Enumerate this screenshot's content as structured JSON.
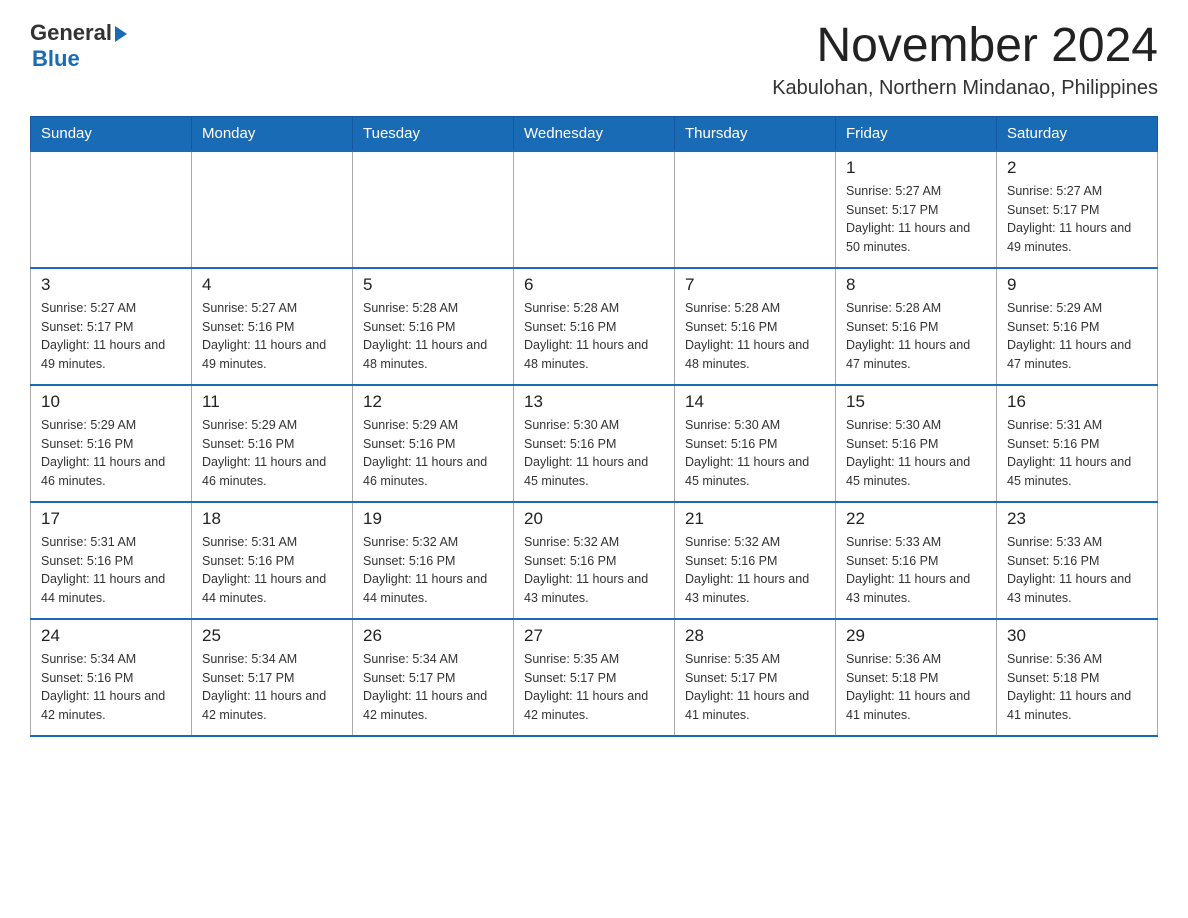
{
  "header": {
    "logo": {
      "general": "General",
      "blue": "Blue",
      "line2": "Blue"
    },
    "title": "November 2024",
    "subtitle": "Kabulohan, Northern Mindanao, Philippines"
  },
  "weekdays": [
    "Sunday",
    "Monday",
    "Tuesday",
    "Wednesday",
    "Thursday",
    "Friday",
    "Saturday"
  ],
  "weeks": [
    [
      {
        "day": "",
        "info": ""
      },
      {
        "day": "",
        "info": ""
      },
      {
        "day": "",
        "info": ""
      },
      {
        "day": "",
        "info": ""
      },
      {
        "day": "",
        "info": ""
      },
      {
        "day": "1",
        "info": "Sunrise: 5:27 AM\nSunset: 5:17 PM\nDaylight: 11 hours and 50 minutes."
      },
      {
        "day": "2",
        "info": "Sunrise: 5:27 AM\nSunset: 5:17 PM\nDaylight: 11 hours and 49 minutes."
      }
    ],
    [
      {
        "day": "3",
        "info": "Sunrise: 5:27 AM\nSunset: 5:17 PM\nDaylight: 11 hours and 49 minutes."
      },
      {
        "day": "4",
        "info": "Sunrise: 5:27 AM\nSunset: 5:16 PM\nDaylight: 11 hours and 49 minutes."
      },
      {
        "day": "5",
        "info": "Sunrise: 5:28 AM\nSunset: 5:16 PM\nDaylight: 11 hours and 48 minutes."
      },
      {
        "day": "6",
        "info": "Sunrise: 5:28 AM\nSunset: 5:16 PM\nDaylight: 11 hours and 48 minutes."
      },
      {
        "day": "7",
        "info": "Sunrise: 5:28 AM\nSunset: 5:16 PM\nDaylight: 11 hours and 48 minutes."
      },
      {
        "day": "8",
        "info": "Sunrise: 5:28 AM\nSunset: 5:16 PM\nDaylight: 11 hours and 47 minutes."
      },
      {
        "day": "9",
        "info": "Sunrise: 5:29 AM\nSunset: 5:16 PM\nDaylight: 11 hours and 47 minutes."
      }
    ],
    [
      {
        "day": "10",
        "info": "Sunrise: 5:29 AM\nSunset: 5:16 PM\nDaylight: 11 hours and 46 minutes."
      },
      {
        "day": "11",
        "info": "Sunrise: 5:29 AM\nSunset: 5:16 PM\nDaylight: 11 hours and 46 minutes."
      },
      {
        "day": "12",
        "info": "Sunrise: 5:29 AM\nSunset: 5:16 PM\nDaylight: 11 hours and 46 minutes."
      },
      {
        "day": "13",
        "info": "Sunrise: 5:30 AM\nSunset: 5:16 PM\nDaylight: 11 hours and 45 minutes."
      },
      {
        "day": "14",
        "info": "Sunrise: 5:30 AM\nSunset: 5:16 PM\nDaylight: 11 hours and 45 minutes."
      },
      {
        "day": "15",
        "info": "Sunrise: 5:30 AM\nSunset: 5:16 PM\nDaylight: 11 hours and 45 minutes."
      },
      {
        "day": "16",
        "info": "Sunrise: 5:31 AM\nSunset: 5:16 PM\nDaylight: 11 hours and 45 minutes."
      }
    ],
    [
      {
        "day": "17",
        "info": "Sunrise: 5:31 AM\nSunset: 5:16 PM\nDaylight: 11 hours and 44 minutes."
      },
      {
        "day": "18",
        "info": "Sunrise: 5:31 AM\nSunset: 5:16 PM\nDaylight: 11 hours and 44 minutes."
      },
      {
        "day": "19",
        "info": "Sunrise: 5:32 AM\nSunset: 5:16 PM\nDaylight: 11 hours and 44 minutes."
      },
      {
        "day": "20",
        "info": "Sunrise: 5:32 AM\nSunset: 5:16 PM\nDaylight: 11 hours and 43 minutes."
      },
      {
        "day": "21",
        "info": "Sunrise: 5:32 AM\nSunset: 5:16 PM\nDaylight: 11 hours and 43 minutes."
      },
      {
        "day": "22",
        "info": "Sunrise: 5:33 AM\nSunset: 5:16 PM\nDaylight: 11 hours and 43 minutes."
      },
      {
        "day": "23",
        "info": "Sunrise: 5:33 AM\nSunset: 5:16 PM\nDaylight: 11 hours and 43 minutes."
      }
    ],
    [
      {
        "day": "24",
        "info": "Sunrise: 5:34 AM\nSunset: 5:16 PM\nDaylight: 11 hours and 42 minutes."
      },
      {
        "day": "25",
        "info": "Sunrise: 5:34 AM\nSunset: 5:17 PM\nDaylight: 11 hours and 42 minutes."
      },
      {
        "day": "26",
        "info": "Sunrise: 5:34 AM\nSunset: 5:17 PM\nDaylight: 11 hours and 42 minutes."
      },
      {
        "day": "27",
        "info": "Sunrise: 5:35 AM\nSunset: 5:17 PM\nDaylight: 11 hours and 42 minutes."
      },
      {
        "day": "28",
        "info": "Sunrise: 5:35 AM\nSunset: 5:17 PM\nDaylight: 11 hours and 41 minutes."
      },
      {
        "day": "29",
        "info": "Sunrise: 5:36 AM\nSunset: 5:18 PM\nDaylight: 11 hours and 41 minutes."
      },
      {
        "day": "30",
        "info": "Sunrise: 5:36 AM\nSunset: 5:18 PM\nDaylight: 11 hours and 41 minutes."
      }
    ]
  ]
}
